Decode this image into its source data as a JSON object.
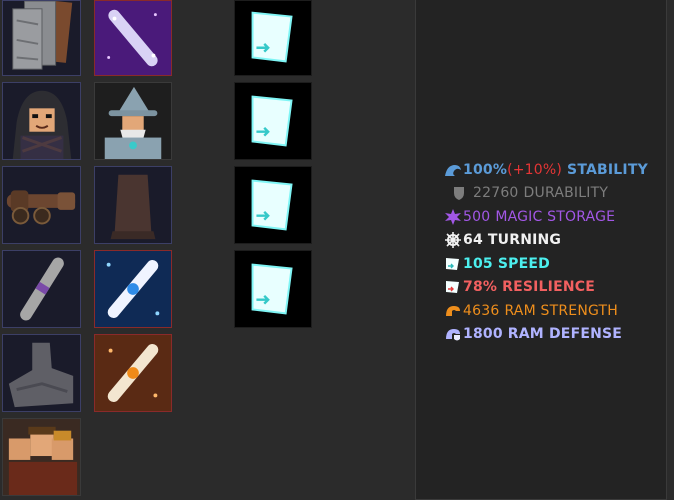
{
  "stats": {
    "stability": {
      "value": "100%",
      "bonus": "(+10%)",
      "label": "STABILITY",
      "color": "#5b9bd8",
      "bonus_color": "#e53535",
      "icon": "wave-icon"
    },
    "durability": {
      "value": "22760",
      "label": "DURABILITY",
      "color": "#7d7d7d",
      "icon": "shield-icon"
    },
    "magic_storage": {
      "value": "500",
      "label": "MAGIC STORAGE",
      "color": "#a257e6",
      "icon": "star-burst-icon"
    },
    "turning": {
      "value": "64",
      "label": "TURNING",
      "color": "#f1f1f1",
      "icon": "ship-wheel-icon"
    },
    "speed": {
      "value": "105",
      "label": "SPEED",
      "color": "#4cf0ef",
      "icon": "sail-icon"
    },
    "resilience": {
      "value": "78%",
      "label": "RESILIENCE",
      "color": "#f26060",
      "icon": "sail-icon"
    },
    "ram_strength": {
      "value": "4636",
      "label": "RAM STRENGTH",
      "color": "#ee8e1c",
      "icon": "ram-icon"
    },
    "ram_defense": {
      "value": "1800",
      "label": "RAM DEFENSE",
      "color": "#b0b3ff",
      "icon": "ram-defense-icon"
    }
  },
  "slots": [
    {
      "icon": "stone-plates-icon"
    },
    {
      "icon": "magic-scroll-purple-icon"
    },
    {
      "icon": "sail-slot-icon"
    },
    {
      "icon": "hooded-pirate-icon"
    },
    {
      "icon": "wizard-icon"
    },
    {
      "icon": "sail-slot-icon"
    },
    {
      "icon": "cannon-icon"
    },
    {
      "icon": "dark-cloth-icon"
    },
    {
      "icon": "sail-slot-icon"
    },
    {
      "icon": "rolled-scroll-icon"
    },
    {
      "icon": "magic-scroll-blue-icon"
    },
    {
      "icon": "sail-slot-icon"
    },
    {
      "icon": "stone-blade-icon"
    },
    {
      "icon": "magic-scroll-orange-icon"
    },
    {
      "icon": "crew-icon"
    }
  ]
}
